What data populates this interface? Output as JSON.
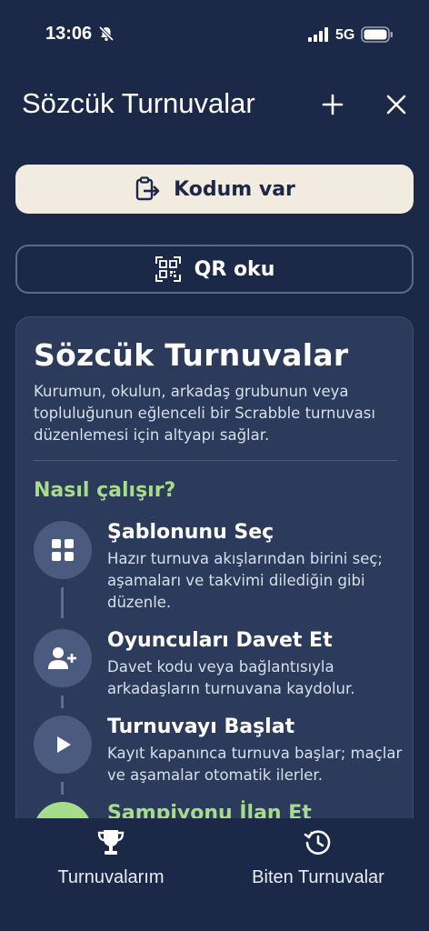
{
  "status_bar": {
    "time": "13:06",
    "network": "5G",
    "icons": [
      "bell-off-icon",
      "signal-icon",
      "battery-icon"
    ]
  },
  "header": {
    "title": "Sözcük Turnuvalar",
    "icons": [
      "plus-icon",
      "close-icon"
    ]
  },
  "actions": {
    "code_button": {
      "label": "Kodum var",
      "icon": "clipboard-arrow-icon"
    },
    "qr_button": {
      "label": "QR oku",
      "icon": "qr-code-icon"
    }
  },
  "info_card": {
    "title": "Sözcük Turnuvalar",
    "description": "Kurumun, okulun, arkadaş grubunun veya topluluğunun eğlenceli bir Scrabble turnuvası düzenlemesi için altyapı sağlar.",
    "how_title": "Nasıl çalışır?",
    "steps": [
      {
        "title": "Şablonunu Seç",
        "description": "Hazır turnuva akışlarından birini seç; aşamaları ve takvimi dilediğin gibi düzenle.",
        "icon": "grid-icon"
      },
      {
        "title": "Oyuncuları Davet Et",
        "description": "Davet kodu veya bağlantısıyla arkadaşların turnuvana kaydolur.",
        "icon": "add-person-icon"
      },
      {
        "title": "Turnuvayı Başlat",
        "description": "Kayıt kapanınca turnuva başlar; maçlar ve aşamalar otomatik ilerler.",
        "icon": "play-icon"
      },
      {
        "title": "Şampiyonu İlan Et",
        "description": "",
        "icon": "trophy-icon"
      }
    ]
  },
  "tab_bar": {
    "tabs": [
      {
        "label": "Turnuvalarım",
        "icon": "trophy-icon"
      },
      {
        "label": "Biten Turnuvalar",
        "icon": "history-icon"
      }
    ]
  },
  "colors": {
    "background": "#1b2848",
    "card": "#2c3b5b",
    "accent_green": "#a6dc8a",
    "primary_button": "#f1ebe0"
  }
}
